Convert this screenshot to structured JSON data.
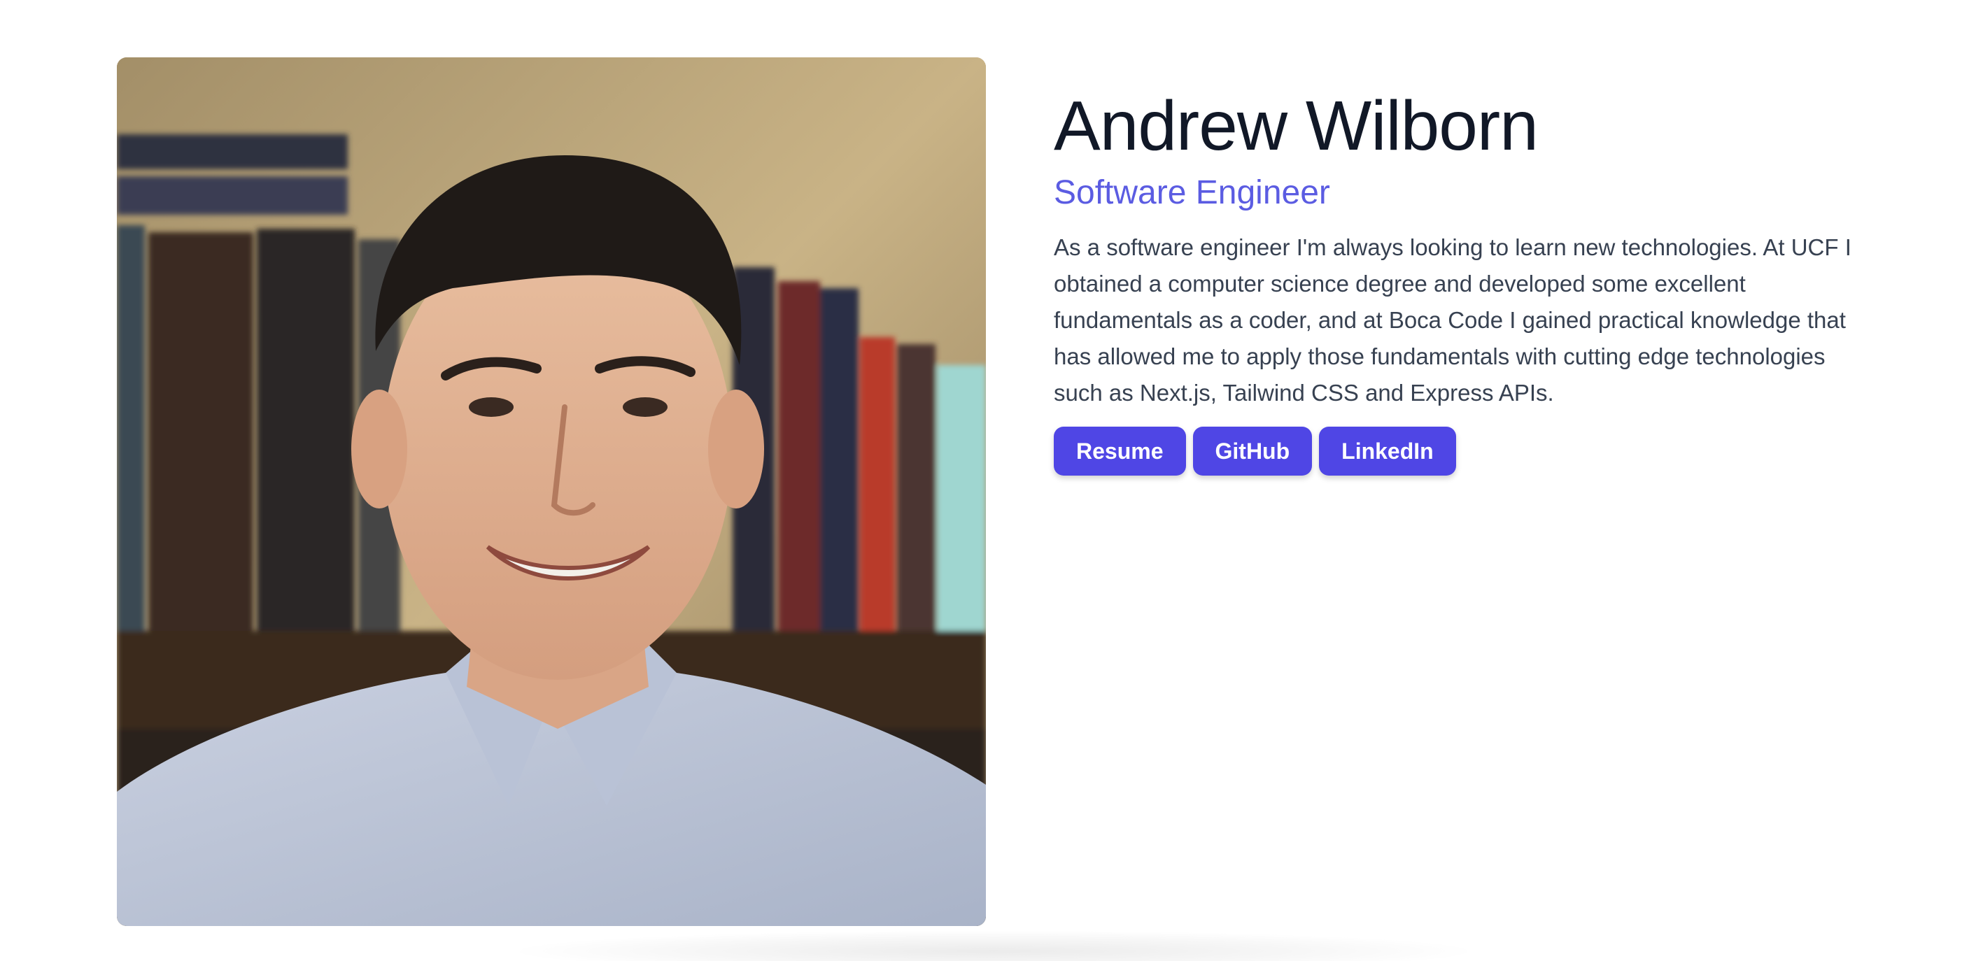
{
  "profile": {
    "name": "Andrew Wilborn",
    "role": "Software Engineer",
    "bio": "As a software engineer I'm always looking to learn new technologies. At UCF I obtained a computer science degree and developed some excellent fundamentals as a coder, and at Boca Code I gained practical knowledge that has allowed me to apply those fundamentals with cutting edge technologies such as Next.js, Tailwind CSS and Express APIs.",
    "photo_alt": "Andrew Wilborn"
  },
  "buttons": {
    "resume": "Resume",
    "github": "GitHub",
    "linkedin": "LinkedIn"
  },
  "colors": {
    "accent": "#4f46e5",
    "role_text": "#5b5ce2",
    "name_text": "#111827",
    "body_text": "#374151"
  }
}
